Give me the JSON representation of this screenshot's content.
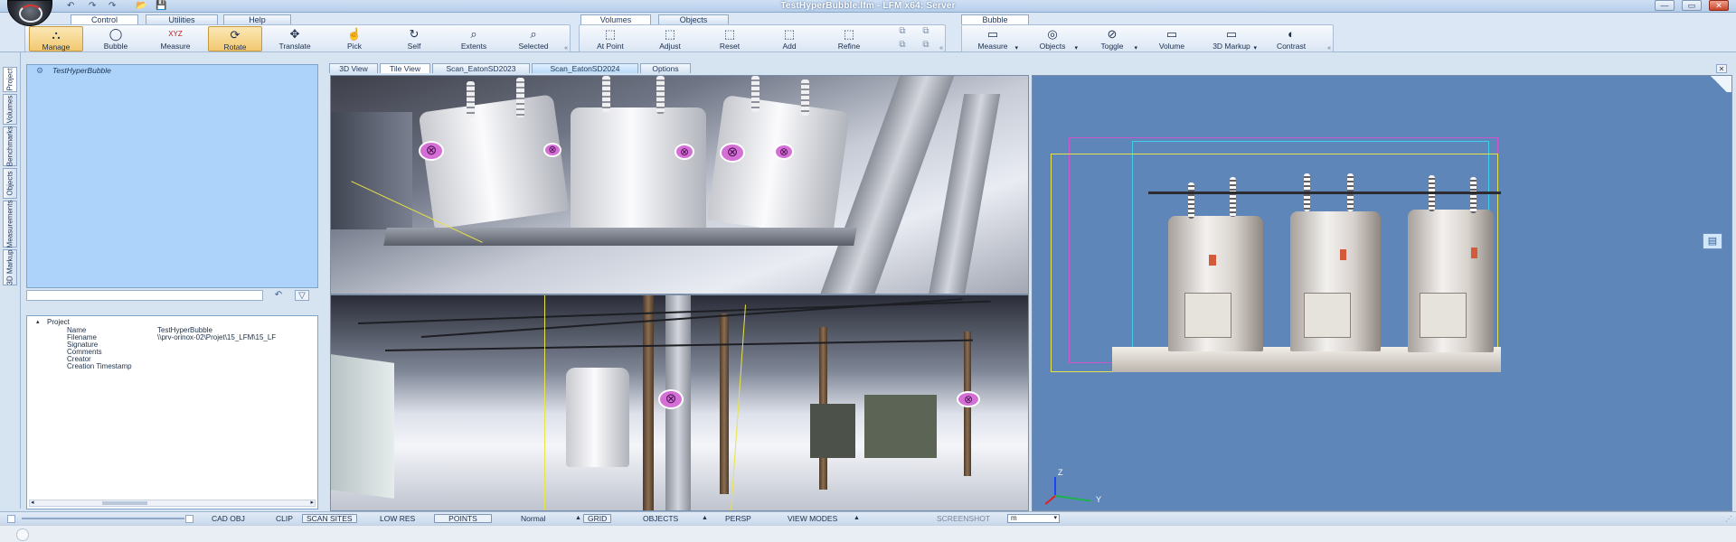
{
  "window": {
    "title": "TestHyperBubble.lfm - LFM x64: Server",
    "quick_access": [
      "↶",
      "↷",
      "↷",
      "📂",
      "💾"
    ],
    "controls": [
      "—",
      "▭",
      "✕"
    ]
  },
  "ribbon": {
    "tabs_left": [
      "Control",
      "Utilities",
      "Help"
    ],
    "tabs_mid": [
      "Volumes",
      "Objects"
    ],
    "tabs_right": [
      "Bubble"
    ],
    "group_control": [
      {
        "label": "Manage",
        "icon": "manage-icon",
        "glyph": "⛬"
      },
      {
        "label": "Bubble",
        "icon": "bubble-icon",
        "glyph": "◯"
      },
      {
        "label": "Measure",
        "icon": "measure-xyz-icon",
        "glyph": "XYZ"
      },
      {
        "label": "Rotate",
        "icon": "rotate-icon",
        "glyph": "⟳"
      },
      {
        "label": "Translate",
        "icon": "translate-icon",
        "glyph": "✥"
      },
      {
        "label": "Pick",
        "icon": "pick-icon",
        "glyph": "☝"
      },
      {
        "label": "Self",
        "icon": "self-icon",
        "glyph": "↻"
      },
      {
        "label": "Extents",
        "icon": "extents-icon",
        "glyph": "⌕"
      },
      {
        "label": "Selected",
        "icon": "selected-icon",
        "glyph": "⌕"
      }
    ],
    "group_volumes": [
      {
        "label": "At Point",
        "icon": "at-point-icon",
        "glyph": "⬚"
      },
      {
        "label": "Adjust",
        "icon": "adjust-icon",
        "glyph": "⬚"
      },
      {
        "label": "Reset",
        "icon": "reset-icon",
        "glyph": "⬚"
      },
      {
        "label": "Add",
        "icon": "add-icon",
        "glyph": "⬚"
      },
      {
        "label": "Refine",
        "icon": "refine-icon",
        "glyph": "⬚"
      }
    ],
    "group_bubble": [
      {
        "label": "Measure",
        "icon": "bubble-measure-icon",
        "glyph": "▭",
        "dropdown": "▾"
      },
      {
        "label": "Objects",
        "icon": "objects-icon",
        "glyph": "◎",
        "dropdown": "▾"
      },
      {
        "label": "Toggle",
        "icon": "toggle-icon",
        "glyph": "⊘",
        "dropdown": "▾"
      },
      {
        "label": "Volume",
        "icon": "volume-icon",
        "glyph": "▭"
      },
      {
        "label": "3D Markup",
        "icon": "markup-icon",
        "glyph": "▭",
        "dropdown": "▾"
      },
      {
        "label": "Contrast",
        "icon": "contrast-icon",
        "glyph": "◐"
      }
    ],
    "launcher": "«"
  },
  "left_tabs": [
    "Project",
    "Volumes",
    "Benchmarks",
    "Objects",
    "Measurements",
    "3D Markup"
  ],
  "project_tree": {
    "root": "TestHyperBubble"
  },
  "filter": {
    "undo_glyph": "↶",
    "apply_glyph": "▽"
  },
  "properties": {
    "root": "Project",
    "rows": [
      {
        "key": "Name",
        "value": "TestHyperBubble"
      },
      {
        "key": "Filename",
        "value": "\\\\prv-orinox-02\\Projet\\15_LFM\\15_LF"
      },
      {
        "key": "Signature",
        "value": ""
      },
      {
        "key": "Comments",
        "value": ""
      },
      {
        "key": "Creator",
        "value": ""
      },
      {
        "key": "Creation Timestamp",
        "value": ""
      }
    ]
  },
  "view_tabs": [
    "3D View",
    "Tile View",
    "Scan_EatonSD2023",
    "Scan_EatonSD2024",
    "Options"
  ],
  "view_tab_active": 1,
  "axis_labels": {
    "z": "Z",
    "y": "Y"
  },
  "statusbar": {
    "items": [
      "CAD OBJ",
      "CLIP",
      "SCAN SITES",
      "LOW RES",
      "POINTS",
      "Normal",
      "GRID",
      "OBJECTS",
      "PERSP",
      "VIEW MODES",
      "SCREENSHOT"
    ],
    "arrow": "▲",
    "unit": "m",
    "unit_dropdown": "▾"
  },
  "colors": {
    "accent": "#aed3fb",
    "viewport_bg": "#5f86b9",
    "bbox_yellow": "#e6e34c",
    "bbox_magenta": "#cc55d0"
  }
}
